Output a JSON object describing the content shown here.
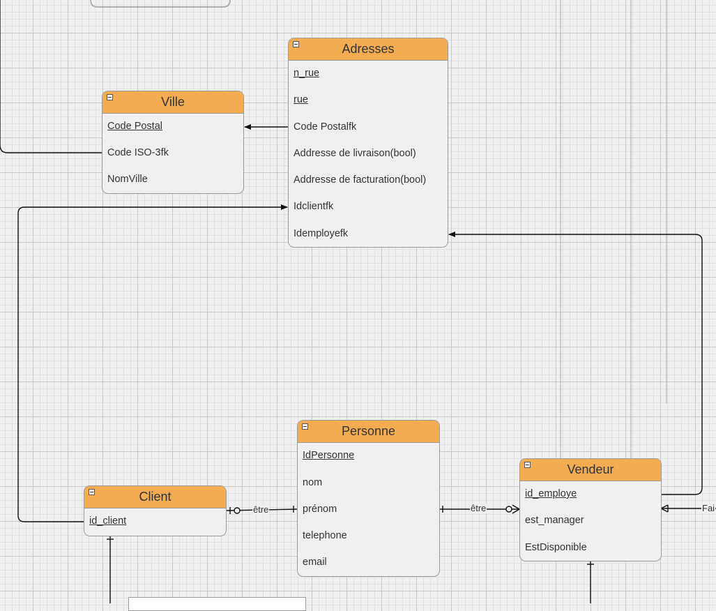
{
  "entities": {
    "adresses": {
      "title": "Adresses",
      "attributes": [
        {
          "label": "n_rue",
          "pk": true
        },
        {
          "label": "rue",
          "pk": true
        },
        {
          "label": "Code Postalfk",
          "pk": false
        },
        {
          "label": "Addresse de livraison(bool)",
          "pk": false
        },
        {
          "label": "Addresse de facturation(bool)",
          "pk": false
        },
        {
          "label": "Idclientfk",
          "pk": false
        },
        {
          "label": "Idemployefk",
          "pk": false
        }
      ]
    },
    "ville": {
      "title": "Ville",
      "attributes": [
        {
          "label": "Code Postal",
          "pk": true
        },
        {
          "label": "Code ISO-3fk",
          "pk": false
        },
        {
          "label": "NomVille",
          "pk": false
        }
      ]
    },
    "personne": {
      "title": "Personne",
      "attributes": [
        {
          "label": "IdPersonne",
          "pk": true
        },
        {
          "label": "nom",
          "pk": false
        },
        {
          "label": "prénom",
          "pk": false
        },
        {
          "label": "telephone",
          "pk": false
        },
        {
          "label": "email",
          "pk": false
        }
      ]
    },
    "client": {
      "title": "Client",
      "attributes": [
        {
          "label": "id_client",
          "pk": true
        }
      ]
    },
    "vendeur": {
      "title": "Vendeur",
      "attributes": [
        {
          "label": "id_employe",
          "pk": true
        },
        {
          "label": "est_manager",
          "pk": false
        },
        {
          "label": "EstDisponible",
          "pk": false
        }
      ]
    }
  },
  "edge_labels": {
    "client_personne": "être",
    "personne_vendeur": "être",
    "vendeur_right": "Fai"
  },
  "colors": {
    "header": "#f4ac53",
    "border": "#9a9a9a",
    "edge": "#111111",
    "background": "#f0f0f0"
  }
}
